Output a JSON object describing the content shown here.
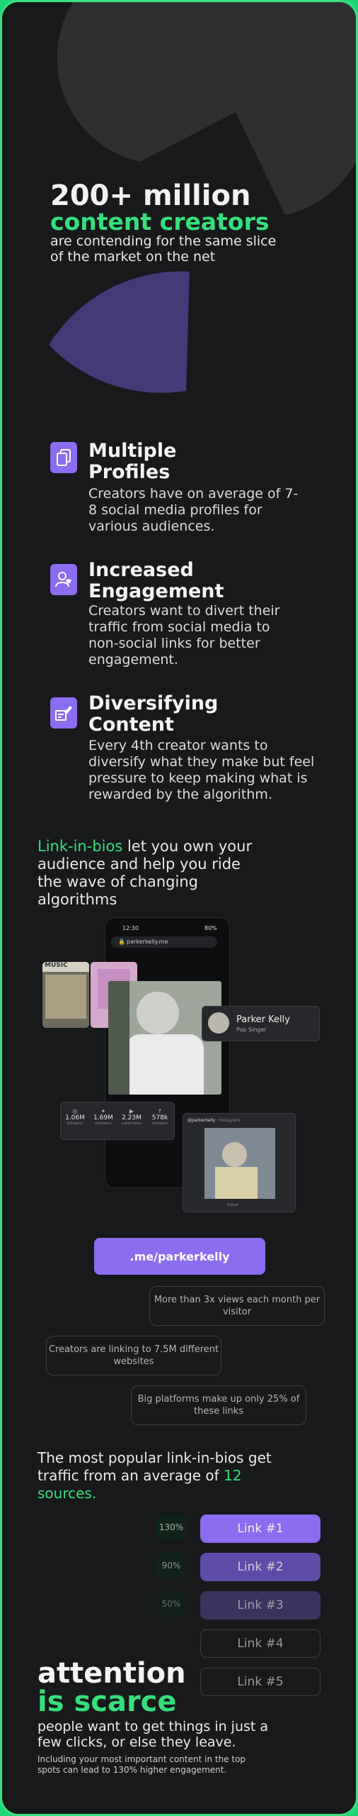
{
  "hero": {
    "title": "200+ million",
    "green": "content creators",
    "subtitle": "are contending for the same slice of the market on the net"
  },
  "features": [
    {
      "title": "Multiple Profiles",
      "text": "Creators have on average of 7-8 social media profiles for various audiences.",
      "icon": "stacked-pages-icon"
    },
    {
      "title": "Increased Engagement",
      "text": "Creators want to divert their traffic from social media to non-social links for better engagement.",
      "icon": "user-heart-icon"
    },
    {
      "title": "Diversifying Content",
      "text": "Every 4th creator wants to diversify what they make but feel pressure to keep making what is rewarded by the algorithm.",
      "icon": "edit-layout-icon"
    }
  ],
  "linkinbio": {
    "green": "Link-in-bios",
    "rest": " let you own your audience and help you ride the wave of changing algorithms"
  },
  "phone": {
    "time": "12:30",
    "battery": "80%",
    "url": "parkerkelly.me",
    "profile_name": "Parker Kelly",
    "profile_role": "Pop Singer",
    "music_label": "MUSIC",
    "stats": [
      {
        "value": "1.06M",
        "label": "followers",
        "icon": "instagram-icon",
        "glyph": "◎"
      },
      {
        "value": "1.69M",
        "label": "followers",
        "icon": "twitter-icon",
        "glyph": "✦"
      },
      {
        "value": "2.23M",
        "label": "subscribers",
        "icon": "youtube-icon",
        "glyph": "▶"
      },
      {
        "value": "578k",
        "label": "followers",
        "icon": "facebook-icon",
        "glyph": "f"
      }
    ],
    "post_handle": "@parkerkelly",
    "post_source": "· Instagram",
    "post_caption": "Follow"
  },
  "domain_button": ".me/parkerkelly",
  "callouts": {
    "views": "More than 3x views each month per visitor",
    "websites": "Creators are linking to 7.5M different websites",
    "platforms": "Big platforms make up only 25% of these links"
  },
  "sources": {
    "text": "The most popular link-in-bios get traffic from an average of ",
    "green": "12 sources."
  },
  "links": [
    {
      "label": "Link #1",
      "pct": "130%"
    },
    {
      "label": "Link #2",
      "pct": "90%"
    },
    {
      "label": "Link #3",
      "pct": "50%"
    },
    {
      "label": "Link #4",
      "pct": ""
    },
    {
      "label": "Link #5",
      "pct": ""
    }
  ],
  "attention": {
    "line1": "attention",
    "line2": "is scarce",
    "sub": "people want to get things in just a few clicks, or else they leave.",
    "small": "Including your most important content in the top spots can lead to 130% higher engagement."
  },
  "colors": {
    "accent_green": "#35e07a",
    "accent_purple": "#8c6cf0",
    "background": "#17191b"
  }
}
